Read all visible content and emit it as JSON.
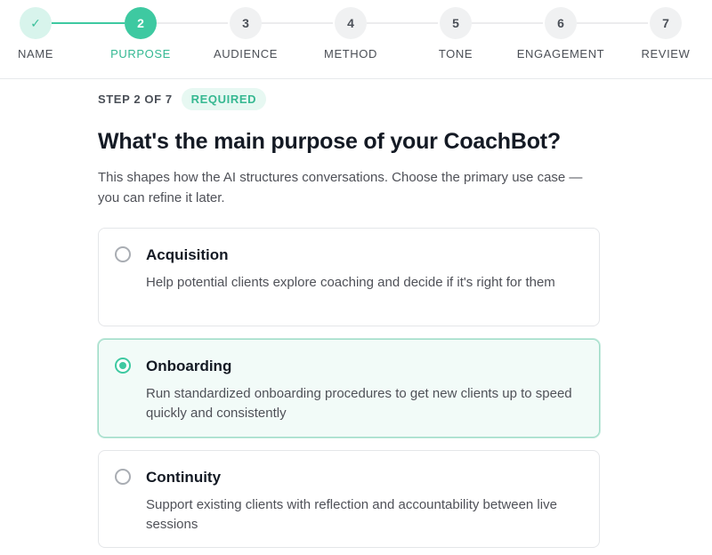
{
  "stepper": {
    "steps": [
      {
        "number": "1",
        "label": "NAME",
        "state": "done",
        "icon": "check-icon"
      },
      {
        "number": "2",
        "label": "PURPOSE",
        "state": "active"
      },
      {
        "number": "3",
        "label": "AUDIENCE",
        "state": "upcoming"
      },
      {
        "number": "4",
        "label": "METHOD",
        "state": "upcoming"
      },
      {
        "number": "5",
        "label": "TONE",
        "state": "upcoming"
      },
      {
        "number": "6",
        "label": "ENGAGEMENT",
        "state": "upcoming"
      },
      {
        "number": "7",
        "label": "REVIEW",
        "state": "upcoming"
      }
    ],
    "check_glyph": "✓"
  },
  "main": {
    "step_count": "STEP 2 OF 7",
    "badge": "REQUIRED",
    "title": "What's the main purpose of your CoachBot?",
    "description": "This shapes how the AI structures conversations. Choose the primary use case — you can refine it later.",
    "options": [
      {
        "title": "Acquisition",
        "description": "Help potential clients explore coaching and decide if it's right for them",
        "selected": false
      },
      {
        "title": "Onboarding",
        "description": "Run standardized onboarding procedures to get new clients up to speed quickly and consistently",
        "selected": true
      },
      {
        "title": "Continuity",
        "description": "Support existing clients with reflection and accountability between live sessions",
        "selected": false
      }
    ]
  },
  "colors": {
    "accent": "#3ec9a1",
    "accent_soft": "#d8f4ec",
    "selected_bg": "#f2fbf8",
    "text_dark": "#141a24",
    "text_muted": "#4f5158"
  }
}
